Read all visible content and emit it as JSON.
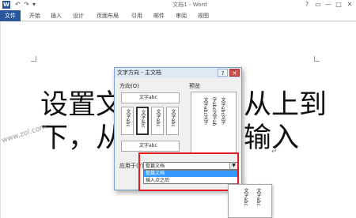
{
  "titlebar": {
    "app_icon": "W",
    "quick_access": [
      "↶",
      "↷",
      "▾"
    ],
    "doc_title": "文档1 - Word",
    "window_buttons": [
      "?",
      "▭",
      "—",
      "□",
      "✕"
    ]
  },
  "ribbon": {
    "tabs": [
      "文件",
      "开始",
      "插入",
      "设计",
      "页面布局",
      "引用",
      "邮件",
      "审阅",
      "视图"
    ]
  },
  "document": {
    "line1_left": "设置文",
    "line1_right": "从上到",
    "line2_left": "下，从",
    "line2_right": "输入",
    "paragraph_mark": "↵",
    "watermark": "www.zol.com"
  },
  "dialog": {
    "title": "文字方向 - 主文档",
    "help_button": "?",
    "close_button": "✕",
    "section_direction": "方向(O)",
    "section_preview": "预览",
    "option_horizontal": "文字abc",
    "option_vertical_1": "文字abc",
    "option_vertical_2": "文字abc",
    "option_vertical_3": "文字abc",
    "option_vertical_4": "文字abc",
    "option_rotated": "文字abc",
    "preview_col1": "文字abc文字",
    "preview_col2": "字abc文字ab",
    "preview_col3": "文字abc文字",
    "apply_label": "应用于(Y):",
    "apply_value": "整篇文档",
    "apply_options": [
      "整篇文档",
      "插入点之后"
    ]
  },
  "ghost_preview": {
    "col1": "文字abc",
    "col2": "文字abc"
  },
  "colors": {
    "word_blue": "#2b579a",
    "highlight_red": "#e21d1d",
    "dropdown_highlight": "#3399ff"
  }
}
